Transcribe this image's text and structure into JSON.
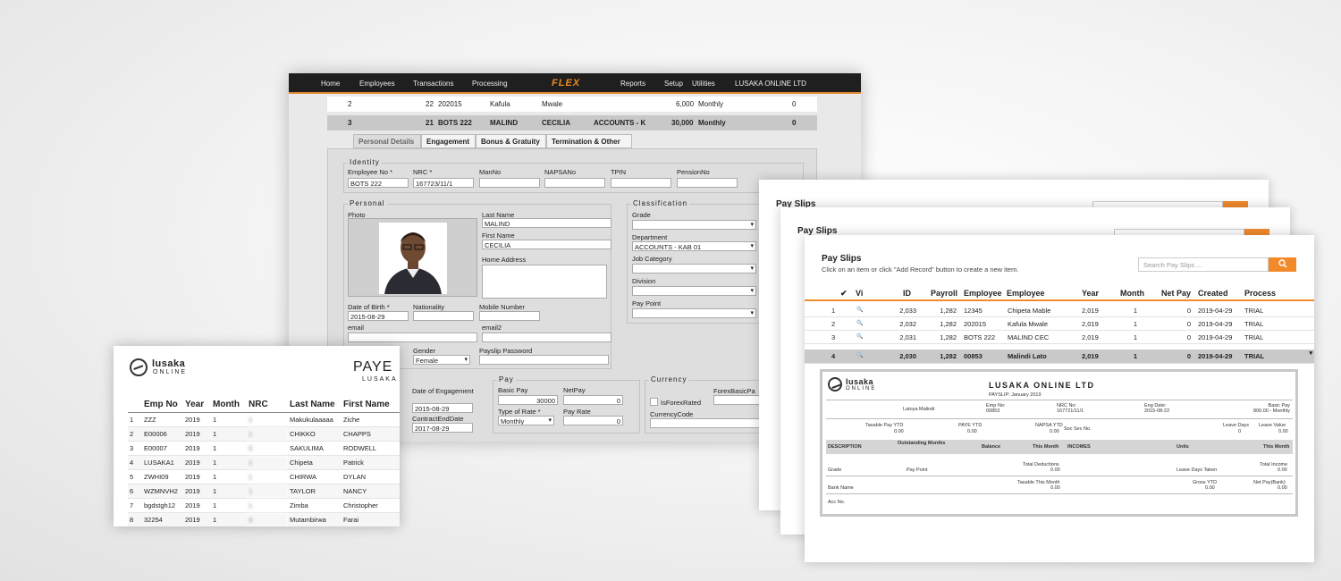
{
  "flex": {
    "nav": [
      "Home",
      "Employees",
      "Transactions",
      "Processing",
      "FLEX",
      "Reports",
      "Setup",
      "Utilities",
      "LUSAKA ONLINE LTD"
    ],
    "row1": [
      "2",
      "22",
      "202015",
      "Kafula",
      "Mwale",
      "6,000",
      "Monthly",
      "0"
    ],
    "row2": [
      "3",
      "21",
      "BOTS 222",
      "MALIND",
      "CECILIA",
      "ACCOUNTS - K",
      "30,000",
      "Monthly",
      "0"
    ],
    "tabs": [
      "Personal Details",
      "Engagement",
      "Bonus & Gratuity",
      "Termination & Other"
    ],
    "identity": {
      "legend": "Identity",
      "labels": [
        "Employee No *",
        "NRC *",
        "ManNo",
        "NAPSANo",
        "TPIN",
        "PensionNo"
      ],
      "values": [
        "BOTS 222",
        "167723/11/1",
        "",
        "",
        "",
        ""
      ]
    },
    "personal": {
      "legend": "Personal",
      "photo_label": "Photo",
      "last_name_label": "Last Name",
      "last_name": "MALIND",
      "first_name_label": "First Name",
      "first_name": "CECILIA",
      "home_address_label": "Home Address",
      "dob_label": "Date of Birth *",
      "dob": "2015-08-29",
      "nationality_label": "Nationality",
      "mobile_label": "Mobile Number",
      "email_label": "email",
      "email2_label": "email2",
      "gender_label": "Gender",
      "gender": "Female",
      "payslip_password_label": "Payslip Password"
    },
    "classification": {
      "legend": "Classification",
      "grade_label": "Grade",
      "department_label": "Department",
      "department": "ACCOUNTS - KAB 01",
      "job_category_label": "Job Category",
      "division_label": "Division",
      "pay_point_label": "Pay Point"
    },
    "dates": {
      "engagement_label": "Date of Engagement",
      "engagement": "2015-08-29",
      "contract_end_label": "ContractEndDate",
      "contract_end": "2017-08-29"
    },
    "pay": {
      "legend": "Pay",
      "basic_pay_label": "Basic Pay",
      "basic_pay": "30000",
      "net_pay_label": "NetPay",
      "net_pay": "0",
      "rate_type_label": "Type of Rate *",
      "rate_type": "Monthly",
      "pay_rate_label": "Pay Rate",
      "pay_rate": "0"
    },
    "currency": {
      "legend": "Currency",
      "is_forex_label": "IsForexRated",
      "forex_basic_label": "ForexBasicPa",
      "currency_code_label": "CurrencyCode"
    }
  },
  "paye": {
    "logo_line1": "lusaka",
    "logo_line2": "ONLINE",
    "title": "PAYE",
    "subtitle": "LUSAKA",
    "columns": [
      "Emp No",
      "Year",
      "Month",
      "NRC",
      "Last Name",
      "First Name"
    ],
    "rows": [
      [
        "1",
        "ZZZ",
        "2019",
        "1",
        "1",
        "Makukulaaaaa",
        "Ziche"
      ],
      [
        "2",
        "E00006",
        "2019",
        "1",
        "1",
        "CHIKKO",
        "CHAPPS"
      ],
      [
        "3",
        "E00007",
        "2019",
        "1",
        "0",
        "SAKULIMA",
        "RODWELL"
      ],
      [
        "4",
        "LUSAKA1",
        "2019",
        "1",
        "1",
        "Chipeta",
        "Patrick"
      ],
      [
        "5",
        "ZWHI09",
        "2019",
        "1",
        "1",
        "CHIRWA",
        "DYLAN"
      ],
      [
        "6",
        "WZMNVH2",
        "2019",
        "1",
        "1",
        "TAYLOR",
        "NANCY"
      ],
      [
        "7",
        "bgdstgh12",
        "2019",
        "1",
        "1",
        "Zimba",
        "Christopher"
      ],
      [
        "8",
        "32254",
        "2019",
        "1",
        "4",
        "Mutambirwa",
        "Farai"
      ]
    ]
  },
  "payslips": {
    "title": "Pay Slips",
    "subtitle": "Click on an item or click \"Add Record\" button to create a new item.",
    "search_placeholder": "Search Pay Slips ...",
    "columns": [
      "✔",
      "Vi",
      "ID",
      "Payroll",
      "Employee",
      "Employee",
      "Year",
      "Month",
      "Net Pay",
      "Created",
      "Process"
    ],
    "rows": [
      [
        "1",
        "2,033",
        "1,282",
        "12345",
        "Chipeta Mable",
        "2,019",
        "1",
        "0",
        "2019-04-29",
        "TRIAL"
      ],
      [
        "2",
        "2,032",
        "1,282",
        "202015",
        "Kafula Mwale",
        "2,019",
        "1",
        "0",
        "2019-04-29",
        "TRIAL"
      ],
      [
        "3",
        "2,031",
        "1,282",
        "BOTS 222",
        "MALIND CEC",
        "2,019",
        "1",
        "0",
        "2019-04-29",
        "TRIAL"
      ],
      [
        "4",
        "2,030",
        "1,282",
        "00853",
        "Malindi Lato",
        "2,019",
        "1",
        "0",
        "2019-04-29",
        "TRIAL"
      ]
    ],
    "slip": {
      "company": "LUSAKA ONLINE LTD",
      "period": "PAYSLIP: January 2019",
      "employee_name": "Latoya Malindi",
      "emp_no_label": "Emp No:",
      "emp_no": "00853",
      "nrc_label": "NRC No:",
      "nrc": "167721/11/1",
      "eng_date_label": "Eng Date:",
      "eng_date": "2015-08-22",
      "basic_pay_label": "Basic Pay",
      "basic_pay": "800.00 - Monthly",
      "taxable_ytd_label": "Taxable Pay YTD",
      "taxable_ytd": "0.00",
      "paye_ytd_label": "PAYE YTD",
      "paye_ytd": "0.00",
      "napsa_ytd_label": "NAPSA YTD",
      "napsa_ytd": "0.00",
      "soc_sec_label": "Soc Sec No.",
      "leave_days_label": "Leave Days",
      "leave_days": "0",
      "leave_value_label": "Leave Value",
      "leave_value": "0.00",
      "desc_label": "DESCRIPTION",
      "outstanding_label": "Outstanding Months",
      "balance_label": "Balance",
      "this_month_label": "This Month",
      "incomes_label": "INCOMES",
      "units_label": "Units",
      "this_month2_label": "This Month",
      "grade_label": "Grade",
      "pay_point_label": "Pay Point",
      "total_deductions_label": "Total Deductions",
      "total_deductions": "0.00",
      "leave_taken_label": "Leave Days Taken",
      "total_income_label": "Total Income",
      "total_income": "0.00",
      "bank_name_label": "Bank Name",
      "taxable_month_label": "Taxable This Month",
      "taxable_month": "0.00",
      "gross_ytd_label": "Gross YTD",
      "gross_ytd": "0.00",
      "net_pay_bank_label": "Net Pay(Bank)",
      "net_pay_bank": "0.00",
      "acc_no_label": "Acc No."
    }
  }
}
